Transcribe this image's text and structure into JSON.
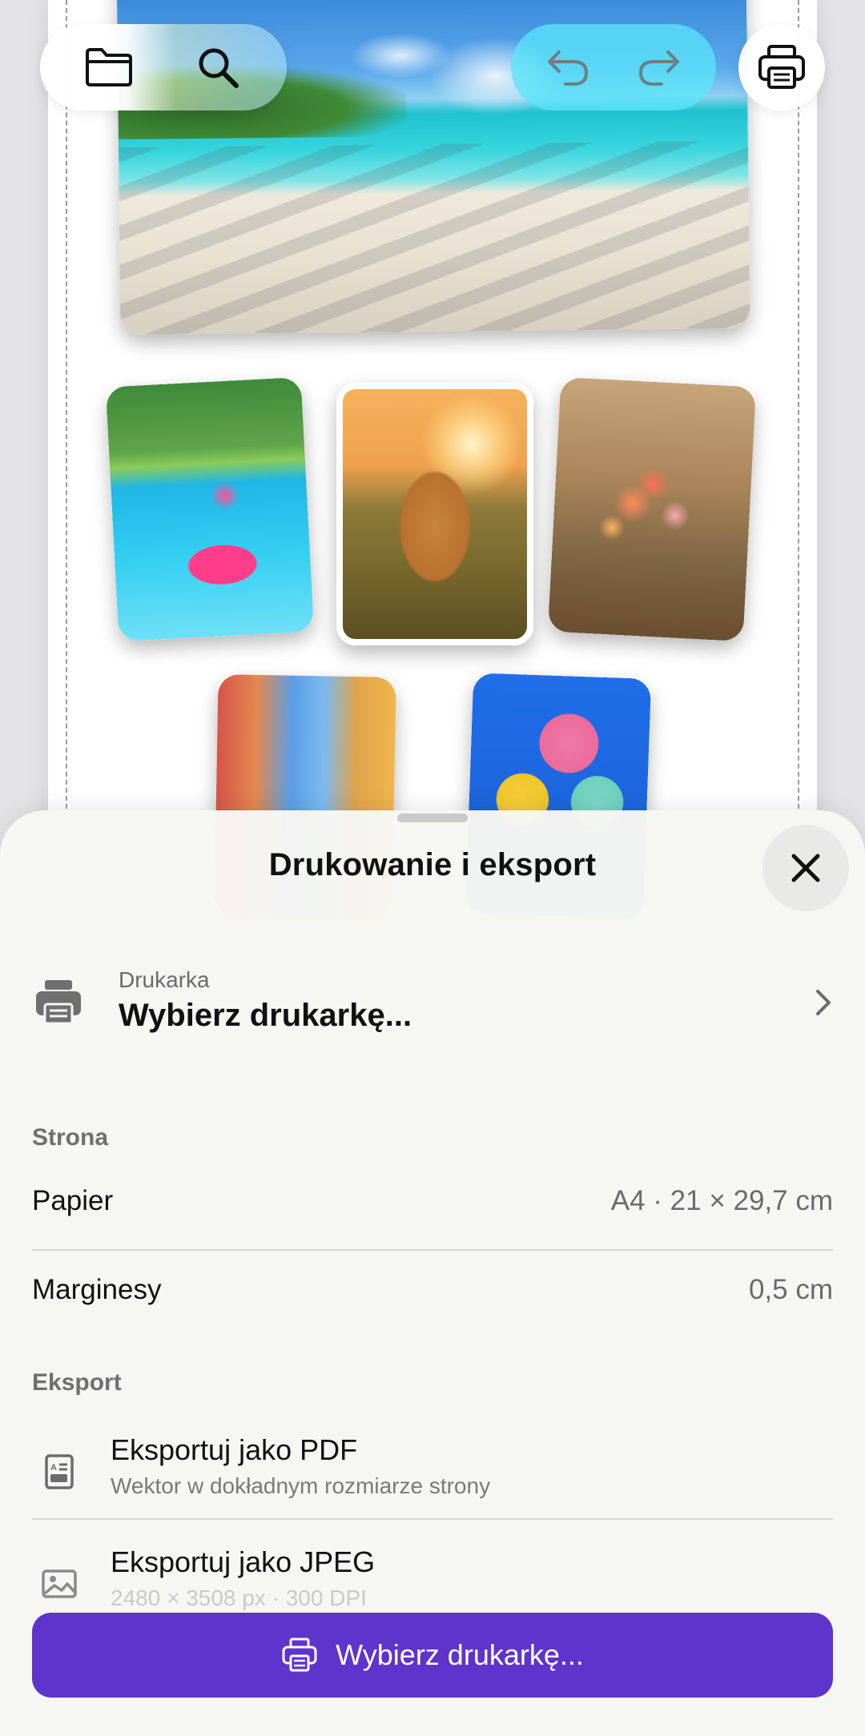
{
  "toolbar": {
    "left_icons": [
      "folder-icon",
      "search-icon"
    ],
    "center_icons": [
      "undo-icon",
      "redo-icon"
    ],
    "right_icon": "printer-icon"
  },
  "canvas": {
    "photos": [
      {
        "name": "beach"
      },
      {
        "name": "flamingo-pool"
      },
      {
        "name": "golden-retriever"
      },
      {
        "name": "flower-bouquet"
      },
      {
        "name": "colorful-street"
      },
      {
        "name": "ice-cream"
      }
    ]
  },
  "sheet": {
    "title": "Drukowanie i eksport",
    "printer": {
      "caption": "Drukarka",
      "value": "Wybierz drukarkę..."
    },
    "page_section": {
      "heading": "Strona",
      "paper_label": "Papier",
      "paper_value": "A4 · 21 × 29,7 cm",
      "margins_label": "Marginesy",
      "margins_value": "0,5 cm"
    },
    "export_section": {
      "heading": "Eksport",
      "pdf_title": "Eksportuj jako PDF",
      "pdf_subtitle": "Wektor w dokładnym rozmiarze strony",
      "jpeg_title": "Eksportuj jako JPEG",
      "jpeg_subtitle": "2480 × 3508 px · 300 DPI"
    },
    "primary_button": "Wybierz drukarkę..."
  },
  "colors": {
    "accent": "#5e34cc",
    "sheet_bg": "#f6f6f3",
    "secondary_text": "#6b6b6b"
  }
}
